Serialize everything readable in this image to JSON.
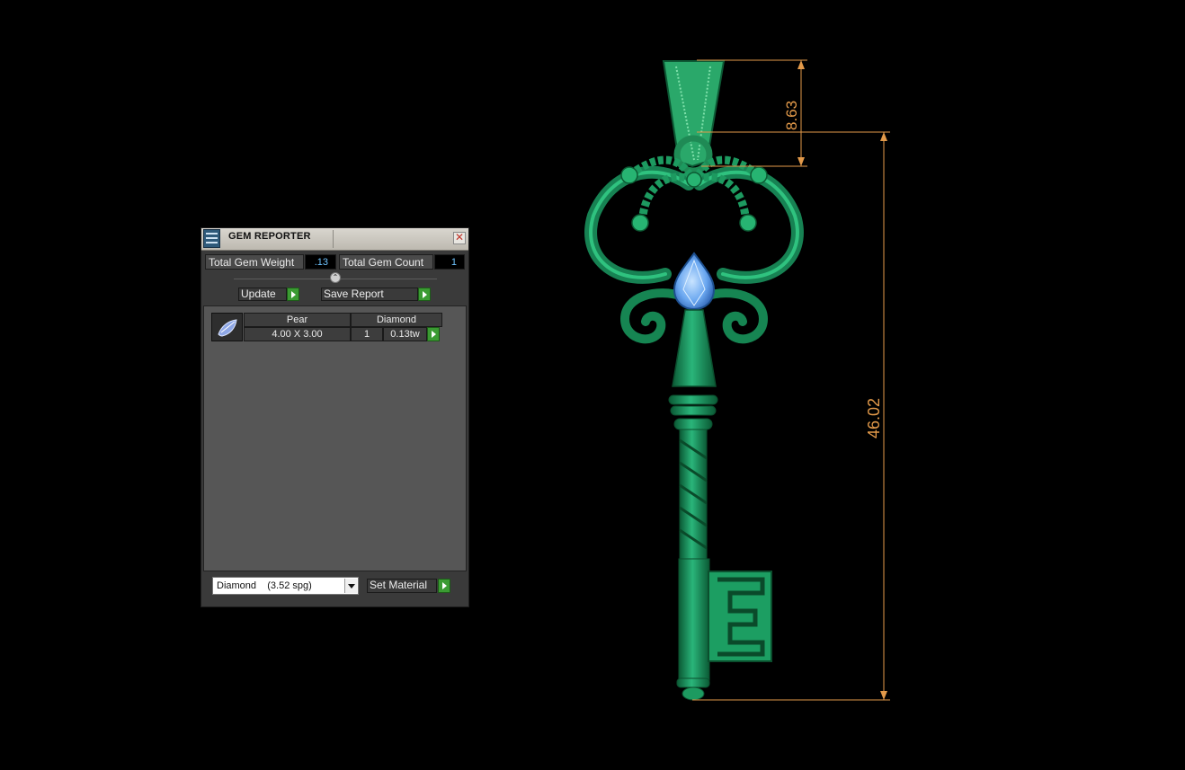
{
  "panel": {
    "title": "GEM REPORTER",
    "close_glyph": "✕",
    "total_gem_weight_label": "Total Gem Weight",
    "total_gem_weight_value": ".13",
    "total_gem_count_label": "Total Gem Count",
    "total_gem_count_value": "1",
    "collapse_glyph": "⌃",
    "update_label": "Update",
    "save_report_label": "Save Report",
    "gems": [
      {
        "shape": "Pear",
        "material": "Diamond",
        "size": "4.00 X 3.00",
        "count": "1",
        "weight": "0.13tw"
      }
    ],
    "material_select_value": "Diamond    (3.52 spg)",
    "set_material_label": "Set Material"
  },
  "viewport": {
    "dimension_top": "8.63",
    "dimension_height": "46.02",
    "dimension_color": "#e39a4a",
    "model_color": "#1a8a5a",
    "gem_color": "#7ab4ff"
  },
  "icons": {
    "title": "gem-report-icon",
    "close": "close-icon",
    "collapse": "collapse-arrow-icon",
    "action_arrow": "play-arrow-icon",
    "gem_thumb": "pear-gem-icon",
    "dropdown": "chevron-down-icon"
  }
}
